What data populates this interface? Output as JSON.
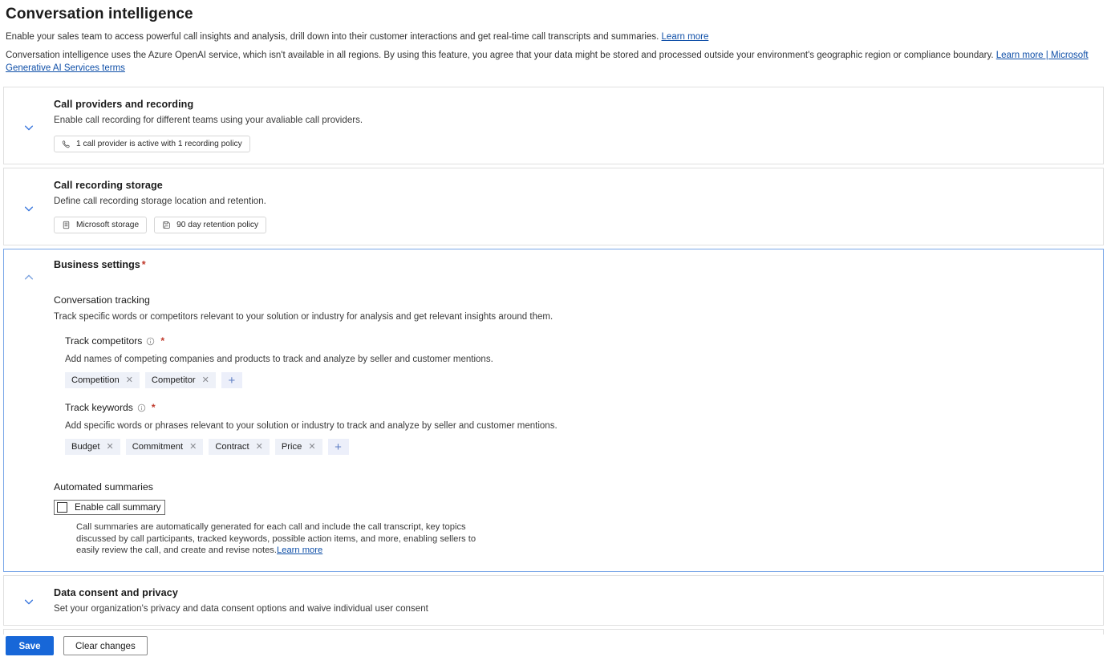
{
  "header": {
    "title": "Conversation intelligence",
    "intro_line1": "Enable your sales team to access powerful call insights and analysis, drill down into their customer interactions and get real-time call transcripts and summaries.",
    "intro_line1_link": "Learn more",
    "intro_line2": "Conversation intelligence uses the Azure OpenAI service, which isn't available in all regions. By using this feature, you agree that your data might be stored and processed outside your environment's geographic region or compliance boundary.",
    "intro_line2_link": "Learn more | Microsoft Generative AI Services terms"
  },
  "cards": {
    "call_providers": {
      "title": "Call providers and recording",
      "description": "Enable call recording for different teams using your avaliable call providers.",
      "chevron_icon": "chevron-down-icon",
      "pill": {
        "icon": "phone-icon",
        "label": "1 call provider is active with 1 recording policy"
      }
    },
    "call_storage": {
      "title": "Call recording storage",
      "description": "Define call recording storage location and retention.",
      "chevron_icon": "chevron-down-icon",
      "pills": [
        {
          "icon": "database-icon",
          "label": "Microsoft storage"
        },
        {
          "icon": "save-icon",
          "label": "90 day retention policy"
        }
      ]
    },
    "business_settings": {
      "title": "Business settings",
      "required_marker": "*",
      "chevron_icon": "chevron-up-icon",
      "conversation_tracking": {
        "heading": "Conversation tracking",
        "description": "Track specific words or competitors relevant to your solution or industry for analysis and get relevant insights around them.",
        "competitors": {
          "label": "Track competitors",
          "info_icon": "info-icon",
          "required_marker": "*",
          "description": "Add names of competing companies and products to track and analyze by seller and customer mentions.",
          "tags": [
            "Competition",
            "Competitor"
          ],
          "add_label": "+"
        },
        "keywords": {
          "label": "Track keywords",
          "info_icon": "info-icon",
          "required_marker": "*",
          "description": "Add specific words or phrases relevant to your solution or industry to track and analyze by seller and customer mentions.",
          "tags": [
            "Budget",
            "Commitment",
            "Contract",
            "Price"
          ],
          "add_label": "+"
        }
      },
      "automated_summaries": {
        "heading": "Automated summaries",
        "checkbox_label": "Enable call summary",
        "checkbox_checked": false,
        "description": "Call summaries are automatically generated for each call and include the call transcript, key topics discussed by call participants, tracked keywords, possible action items, and more, enabling sellers to easily review the call, and create and revise notes.",
        "description_link": "Learn more"
      }
    },
    "data_consent": {
      "title": "Data consent and privacy",
      "description": "Set your organization's privacy and data consent options and waive individual user consent",
      "chevron_icon": "chevron-down-icon"
    }
  },
  "footer": {
    "save_label": "Save",
    "clear_label": "Clear changes"
  },
  "colors": {
    "accent": "#1767d8",
    "chevron": "#3a77dd",
    "expanded_border": "#7aa7e8",
    "required": "#c0392b",
    "chip_bg": "#eef1f8",
    "link": "#0f4fa8"
  }
}
